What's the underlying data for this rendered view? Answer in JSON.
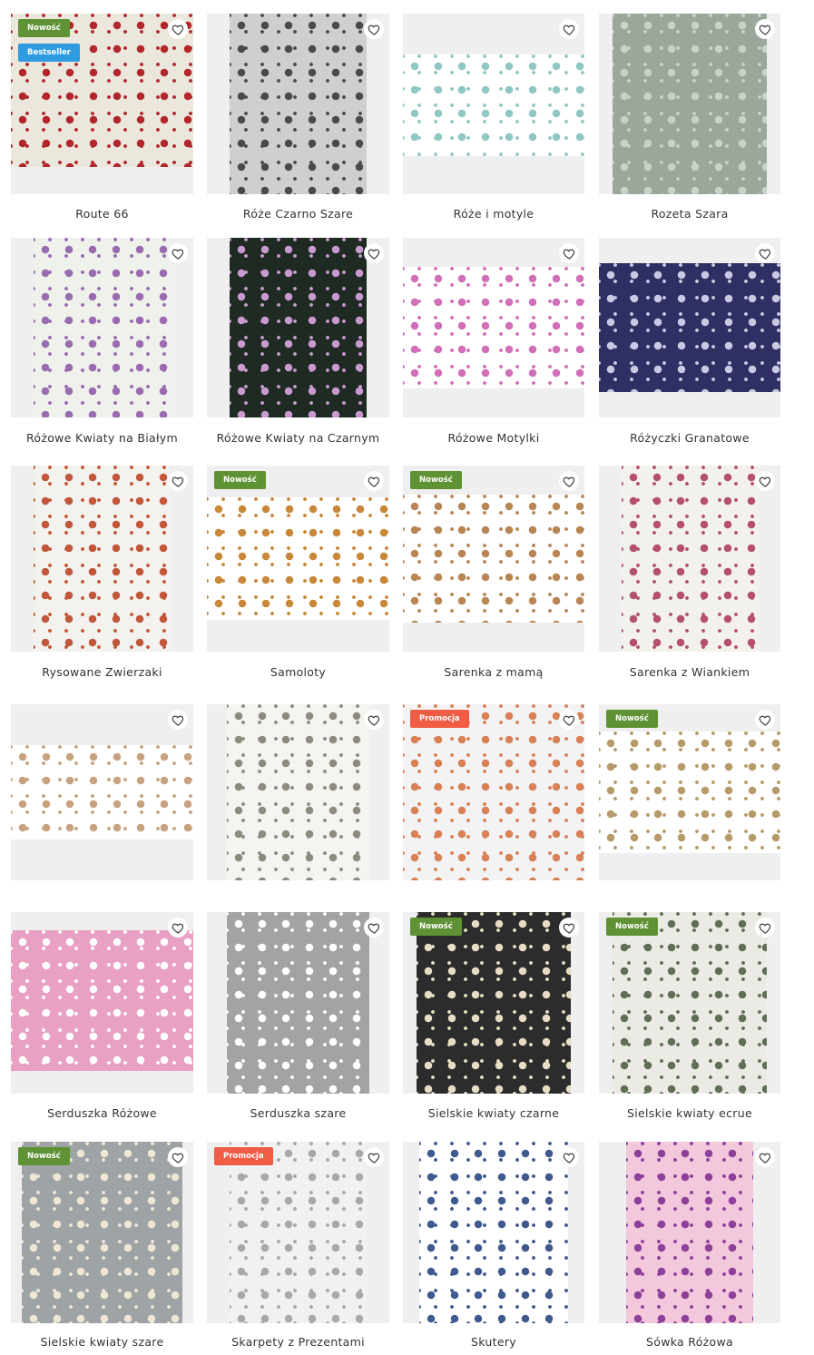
{
  "badges": {
    "new": "Nowość",
    "bestseller": "Bestseller",
    "promo": "Promocja"
  },
  "icons": {
    "favorite": "heart-outline-icon"
  },
  "products": [
    {
      "title": "Route 66",
      "badges": [
        "new",
        "bestseller"
      ],
      "bg": "#ece7dd",
      "color": "#b3262a"
    },
    {
      "title": "Róże Czarno Szare",
      "badges": [],
      "bg": "#cfcfcf",
      "color": "#4a4a4a"
    },
    {
      "title": "Róże i motyle",
      "badges": [],
      "bg": "#ffffff",
      "color": "#8fc7c4"
    },
    {
      "title": "Rozeta Szara",
      "badges": [],
      "bg": "#9aa79a",
      "color": "#c9d2c9"
    },
    {
      "title": "Różowe Kwiaty na Białym",
      "badges": [],
      "bg": "#eef2ea",
      "color": "#9a6bb0"
    },
    {
      "title": "Różowe Kwiaty na Czarnym",
      "badges": [],
      "bg": "#1e2a22",
      "color": "#c99ad0"
    },
    {
      "title": "Różowe Motylki",
      "badges": [],
      "bg": "#ffffff",
      "color": "#d16fb9"
    },
    {
      "title": "Różyczki Granatowe",
      "badges": [],
      "bg": "#2f2f63",
      "color": "#c9c9e6"
    },
    {
      "title": "Rysowane Zwierzaki",
      "badges": [],
      "bg": "#f3f2ef",
      "color": "#c2563a"
    },
    {
      "title": "Samoloty",
      "badges": [
        "new"
      ],
      "bg": "#ffffff",
      "color": "#c8883a"
    },
    {
      "title": "Sarenka z mamą",
      "badges": [
        "new"
      ],
      "bg": "#ffffff",
      "color": "#b98553"
    },
    {
      "title": "Sarenka z Wiankiem",
      "badges": [],
      "bg": "#f3f1ec",
      "color": "#b5506c"
    },
    {
      "title": "",
      "badges": [],
      "bg": "#ffffff",
      "color": "#c8a27e"
    },
    {
      "title": "",
      "badges": [],
      "bg": "#f4f4f1",
      "color": "#8d8a7e"
    },
    {
      "title": "",
      "badges": [
        "promo"
      ],
      "bg": "#f3f3f3",
      "color": "#d98055"
    },
    {
      "title": "",
      "badges": [
        "new"
      ],
      "bg": "#ffffff",
      "color": "#b59a6a"
    },
    {
      "title": "Serduszka Różowe",
      "badges": [],
      "bg": "#e8a0c3",
      "color": "#ffffff"
    },
    {
      "title": "Serduszka szare",
      "badges": [],
      "bg": "#a3a3a3",
      "color": "#ffffff"
    },
    {
      "title": "Sielskie kwiaty czarne",
      "badges": [
        "new"
      ],
      "bg": "#2c2c2c",
      "color": "#e7dcc5"
    },
    {
      "title": "Sielskie kwiaty ecrue",
      "badges": [
        "new"
      ],
      "bg": "#eceae5",
      "color": "#5f6f55"
    },
    {
      "title": "Sielskie kwiaty szare",
      "badges": [
        "new"
      ],
      "bg": "#9ea3a6",
      "color": "#efe7d5"
    },
    {
      "title": "Skarpety z Prezentami",
      "badges": [
        "promo"
      ],
      "bg": "#f1f1f1",
      "color": "#a8a8a8"
    },
    {
      "title": "Skutery",
      "badges": [],
      "bg": "#ffffff",
      "color": "#3f5a8f"
    },
    {
      "title": "Sówka Różowa",
      "badges": [],
      "bg": "#f4c8dc",
      "color": "#8d3f9a"
    }
  ]
}
